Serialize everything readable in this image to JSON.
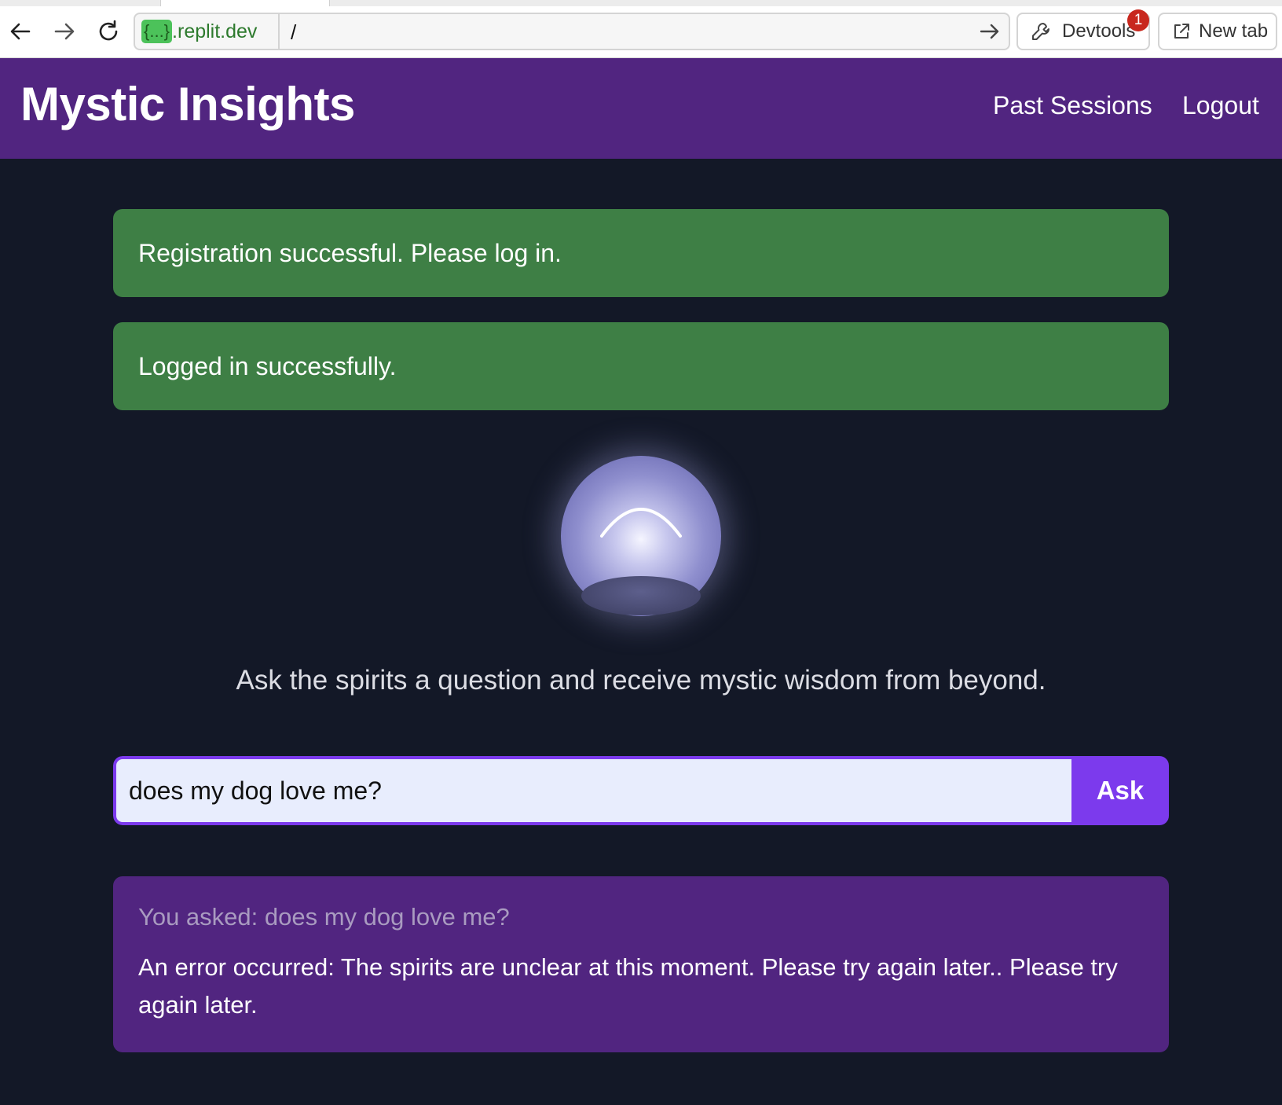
{
  "browser": {
    "url_host_chip": "{...}",
    "url_host_suffix": ".replit.dev",
    "url_path": "/",
    "devtools_label": "Devtools",
    "devtools_badge": "1",
    "new_tab_label": "New tab"
  },
  "header": {
    "title": "Mystic Insights",
    "nav": {
      "past_sessions": "Past Sessions",
      "logout": "Logout"
    }
  },
  "flashes": [
    "Registration successful. Please log in.",
    "Logged in successfully."
  ],
  "main": {
    "tagline": "Ask the spirits a question and receive mystic wisdom from beyond.",
    "question_input": {
      "value": "does my dog love me?"
    },
    "ask_button": "Ask"
  },
  "response": {
    "asked": "You asked: does my dog love me?",
    "answer": "An error occurred: The spirits are unclear at this moment. Please try again later.. Please try again later."
  },
  "colors": {
    "header_bg": "#512580",
    "page_bg": "#131827",
    "flash_success": "#3e7f45",
    "accent": "#7c3aed"
  }
}
